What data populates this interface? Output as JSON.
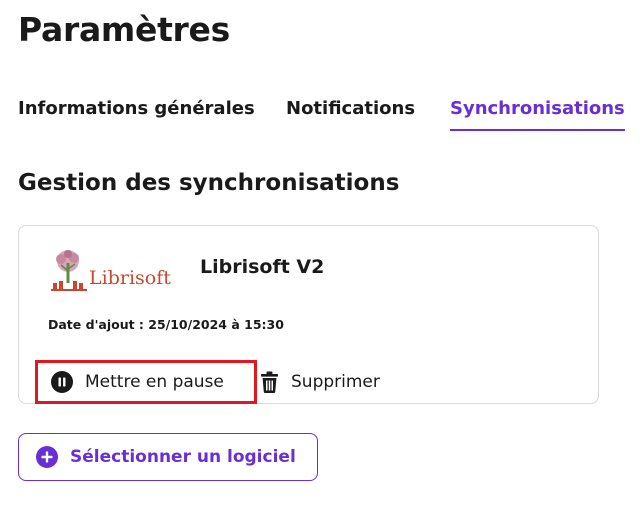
{
  "header": {
    "title": "Paramètres"
  },
  "tabs": [
    {
      "label": "Informations générales",
      "active": false
    },
    {
      "label": "Notifications",
      "active": false
    },
    {
      "label": "Synchronisations",
      "active": true
    }
  ],
  "section": {
    "title": "Gestion des synchronisations"
  },
  "sync_card": {
    "logo_text": "Librisoft",
    "logo_icon": "tree-logo-icon",
    "app_name": "Librisoft V2",
    "date_added": "Date d'ajout : 25/10/2024 à 15:30",
    "pause_label": "Mettre en pause",
    "pause_icon": "pause-circle-icon",
    "delete_label": "Supprimer",
    "delete_icon": "trash-icon"
  },
  "select_software": {
    "label": "Sélectionner un logiciel",
    "icon": "plus-circle-icon"
  },
  "colors": {
    "accent": "#6a2fd4",
    "highlight_border": "#e1191f",
    "logo_red": "#c9472f",
    "text": "#1a1a1a",
    "card_border": "#d9d9d9"
  }
}
